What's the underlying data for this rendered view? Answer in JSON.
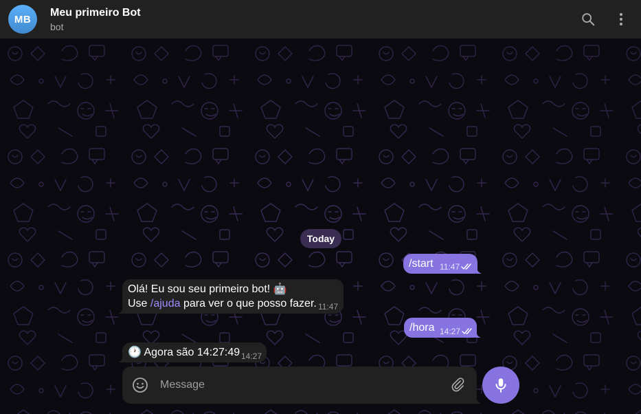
{
  "header": {
    "avatar_initials": "MB",
    "title": "Meu primeiro Bot",
    "subtitle": "bot",
    "icons": [
      "search-icon",
      "more-vertical-icon"
    ]
  },
  "chat": {
    "date_chip": "Today",
    "messages": [
      {
        "direction": "out",
        "text": "/start",
        "time": "11:47",
        "status": "read"
      },
      {
        "direction": "in",
        "line1": "Olá! Eu sou seu primeiro bot! 🤖",
        "line2_before": "Use ",
        "line2_link": "/ajuda",
        "line2_after": " para ver o que posso fazer.",
        "time": "11:47"
      },
      {
        "direction": "out",
        "text": "/hora",
        "time": "14:27",
        "status": "read"
      },
      {
        "direction": "in",
        "text": "🕐 Agora são 14:27:49",
        "time": "14:27"
      }
    ]
  },
  "composer": {
    "placeholder": "Message",
    "value": "",
    "icons": [
      "emoji-icon",
      "attach-icon",
      "microphone-icon"
    ]
  },
  "colors": {
    "header_bg": "#212121",
    "outgoing_bubble": "#8774e1",
    "incoming_bubble": "#212121",
    "link": "#a18cff",
    "date_chip_bg": "#3a2d52"
  }
}
